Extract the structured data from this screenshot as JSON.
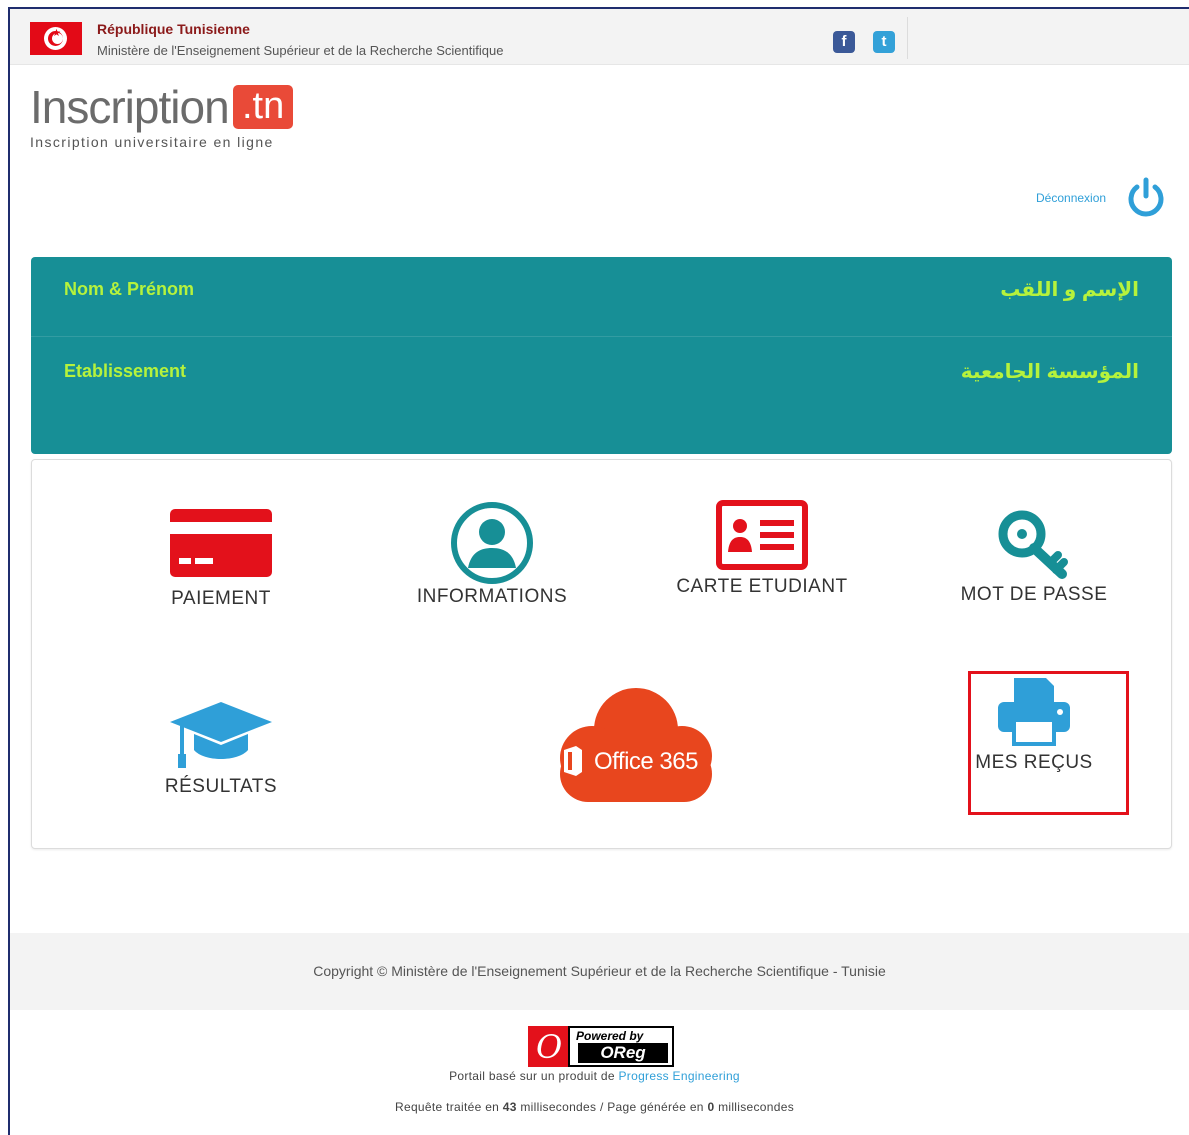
{
  "header": {
    "country": "République Tunisienne",
    "ministry": "Ministère de l'Enseignement Supérieur et de la Recherche Scientifique",
    "social": {
      "facebook_glyph": "f",
      "twitter_glyph": "t"
    }
  },
  "logo": {
    "word": "Inscription",
    "tld": ".tn",
    "tagline": "Inscription universitaire en ligne"
  },
  "user_bar": {
    "logout_label": "Déconnexion",
    "logout_icon": "power-icon"
  },
  "profile": {
    "name_label": "Nom & Prénom",
    "name_label_ar": "الإسم و اللقب",
    "institution_label": "Etablissement",
    "institution_label_ar": "المؤسسة الجامعية",
    "panel_color": "#178f96",
    "label_color": "#b6f23c"
  },
  "menu": {
    "payment": "PAIEMENT",
    "informations": "INFORMATIONS",
    "student_card": "CARTE ETUDIANT",
    "password": "MOT DE PASSE",
    "results": "RÉSULTATS",
    "office": "Office 365",
    "receipts": "MES REÇUS",
    "highlight_color": "#e3111b"
  },
  "footer": {
    "copyright": "Copyright © Ministère de l'Enseignement Supérieur et de la Recherche Scientifique - Tunisie",
    "powered_by": "Powered by",
    "oreg": "OReg",
    "portal_prefix": "Portail basé sur un produit de",
    "portal_link": "Progress Engineering",
    "req_prefix": "Requête traitée en",
    "req_ms": "43",
    "req_middle": "millisecondes / Page générée en",
    "page_ms": "0",
    "req_suffix": "millisecondes"
  }
}
